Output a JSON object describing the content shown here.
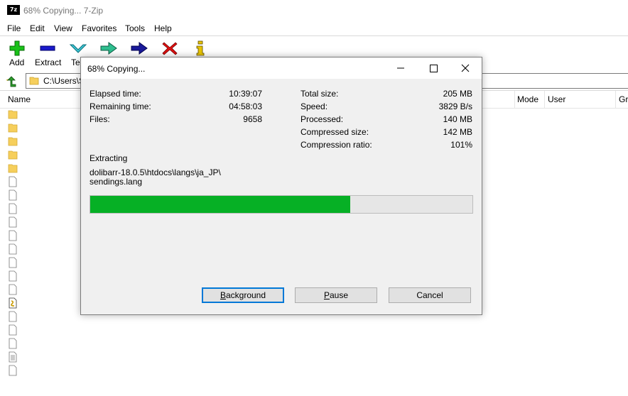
{
  "window": {
    "icon_text": "7z",
    "title": "68% Copying... 7-Zip"
  },
  "menu": [
    "File",
    "Edit",
    "View",
    "Favorites",
    "Tools",
    "Help"
  ],
  "toolbar": {
    "add": "Add",
    "extract": "Extract",
    "test": "Te"
  },
  "address": {
    "path": "C:\\Users\\S"
  },
  "columns": {
    "name": "Name",
    "mode": "Mode",
    "user": "User",
    "group": "Gr"
  },
  "dialog": {
    "title": "68% Copying...",
    "elapsed_label": "Elapsed time:",
    "elapsed_value": "10:39:07",
    "remaining_label": "Remaining time:",
    "remaining_value": "04:58:03",
    "files_label": "Files:",
    "files_value": "9658",
    "total_size_label": "Total size:",
    "total_size_value": "205 MB",
    "speed_label": "Speed:",
    "speed_value": "3829 B/s",
    "processed_label": "Processed:",
    "processed_value": "140 MB",
    "compressed_label": "Compressed size:",
    "compressed_value": "142 MB",
    "ratio_label": "Compression ratio:",
    "ratio_value": "101%",
    "operation": "Extracting",
    "path_line1": "dolibarr-18.0.5\\htdocs\\langs\\ja_JP\\",
    "path_line2": "sendings.lang",
    "progress_percent": 68,
    "background_first": "B",
    "background_rest": "ackground",
    "pause_first": "P",
    "pause_rest": "ause",
    "cancel": "Cancel"
  },
  "colors": {
    "progress_fill": "#06b025",
    "progress_track": "#e6e6e6",
    "dialog_bg": "#f0f0f0",
    "accent": "#0078d7"
  }
}
